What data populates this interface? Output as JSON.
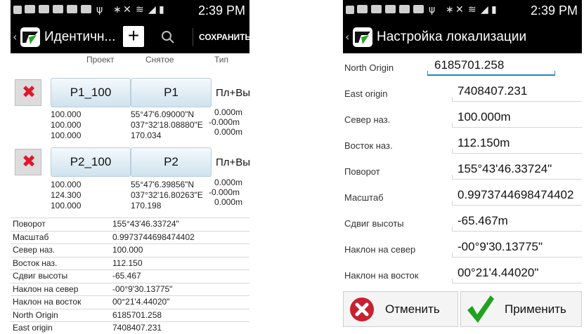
{
  "status": {
    "time": "2:39 PM"
  },
  "icons": {
    "delete": "x-icon",
    "search": "search-icon",
    "add": "plus-icon",
    "cancel": "cancel-icon",
    "apply": "checkmark-icon",
    "logo": "app-logo-icon"
  },
  "colors": {
    "delete_red": "#e0162b",
    "apply_green": "#1fa21f",
    "focus_blue": "#1e88c6"
  },
  "left": {
    "title": "Идентичн...",
    "add_label": "+",
    "save_label": "СОХРАНИТЬ",
    "columns": [
      "Проект",
      "Снятое",
      "Тип"
    ],
    "pairs": [
      {
        "project": "P1_100",
        "measured": "P1",
        "type": "Пл+Вы",
        "proj_coords": [
          "100.000",
          "100.000",
          "100.000"
        ],
        "meas_coords": [
          "55°47'6.09000\"N",
          "037°32'18.08880\"E",
          "170.034"
        ],
        "diffs": [
          "0.000m",
          "-0.000m",
          "0.000m"
        ]
      },
      {
        "project": "P2_100",
        "measured": "P2",
        "type": "Пл+Вы",
        "proj_coords": [
          "100.000",
          "124.300",
          "100.000"
        ],
        "meas_coords": [
          "55°47'6.39856\"N",
          "037°32'16.80263\"E",
          "170.198"
        ],
        "diffs": [
          "0.000m",
          "-0.000m",
          "0.000m"
        ]
      }
    ],
    "params": [
      {
        "label": "Поворот",
        "value": "155°43'46.33724\""
      },
      {
        "label": "Масштаб",
        "value": "0.9973744698474402"
      },
      {
        "label": "Север наз.",
        "value": "100.000"
      },
      {
        "label": "Восток наз.",
        "value": "112.150"
      },
      {
        "label": "Сдвиг высоты",
        "value": "-65.467"
      },
      {
        "label": "Наклон на север",
        "value": "-00°9'30.13775\""
      },
      {
        "label": "Наклон на восток",
        "value": "00°21'4.44020\""
      },
      {
        "label": "North Origin",
        "value": "6185701.258"
      },
      {
        "label": "East origin",
        "value": "7408407.231"
      }
    ]
  },
  "right": {
    "title": "Настройка локализации",
    "fields": [
      {
        "label": "North Origin",
        "value": "6185701.258"
      },
      {
        "label": "East origin",
        "value": "7408407.231"
      },
      {
        "label": "Север наз.",
        "value": "100.000m"
      },
      {
        "label": "Восток наз.",
        "value": "112.150m"
      },
      {
        "label": "Поворот",
        "value": "155°43'46.33724\""
      },
      {
        "label": "Масштаб",
        "value": "0.9973744698474402"
      },
      {
        "label": "Сдвиг высоты",
        "value": "-65.467m"
      },
      {
        "label": "Наклон на север",
        "value": "-00°9'30.13775\""
      },
      {
        "label": "Наклон на восток",
        "value": "00°21'4.44020\""
      }
    ],
    "cancel_label": "Отменить",
    "apply_label": "Применить"
  }
}
